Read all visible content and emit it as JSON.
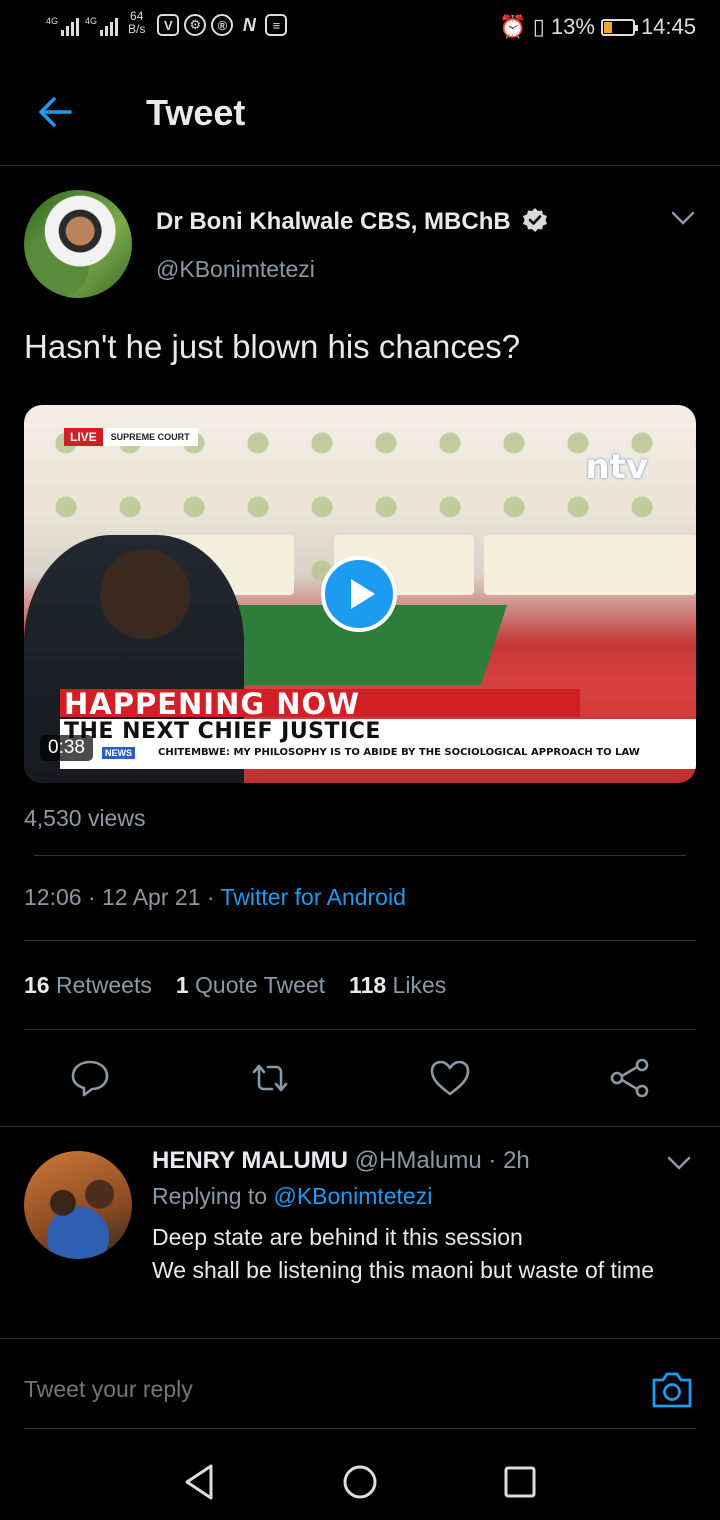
{
  "status_bar": {
    "net1": "4G",
    "net2": "4G",
    "speed_value": "64",
    "speed_unit": "B/s",
    "battery": "13%",
    "battery_level_pct": 13,
    "time": "14:45"
  },
  "header": {
    "title": "Tweet"
  },
  "tweet": {
    "author_name": "Dr Boni Khalwale CBS, MBChB",
    "author_handle": "@KBonimtetezi",
    "text": "Hasn't he just blown his chances?",
    "media": {
      "live_label": "LIVE",
      "live_sub": "SUPREME COURT",
      "channel": "ntv",
      "headline": "HAPPENING NOW",
      "subheadline": "THE NEXT CHIEF JUSTICE",
      "news_tag": "NEWS",
      "ticker": "CHITEMBWE: MY PHILOSOPHY IS TO ABIDE BY THE SOCIOLOGICAL APPROACH TO LAW",
      "duration": "0:38"
    },
    "views": "4,530 views",
    "time": "12:06",
    "date": "12 Apr 21",
    "client": "Twitter for Android",
    "retweets_count": "16",
    "retweets_label": "Retweets",
    "quotes_count": "1",
    "quotes_label": "Quote Tweet",
    "likes_count": "118",
    "likes_label": "Likes"
  },
  "reply": {
    "name": "HENRY MALUMU",
    "handle": "@HMalumu",
    "age": "· 2h",
    "replying_prefix": "Replying to",
    "replying_handle": "@KBonimtetezi",
    "line1": "Deep state are behind it this session",
    "line2": "We shall be listening this maoni but waste of time"
  },
  "composer": {
    "placeholder": "Tweet your reply"
  },
  "colors": {
    "accent": "#1d9bf0",
    "background": "#000000",
    "secondary_text": "#8b98a5"
  }
}
